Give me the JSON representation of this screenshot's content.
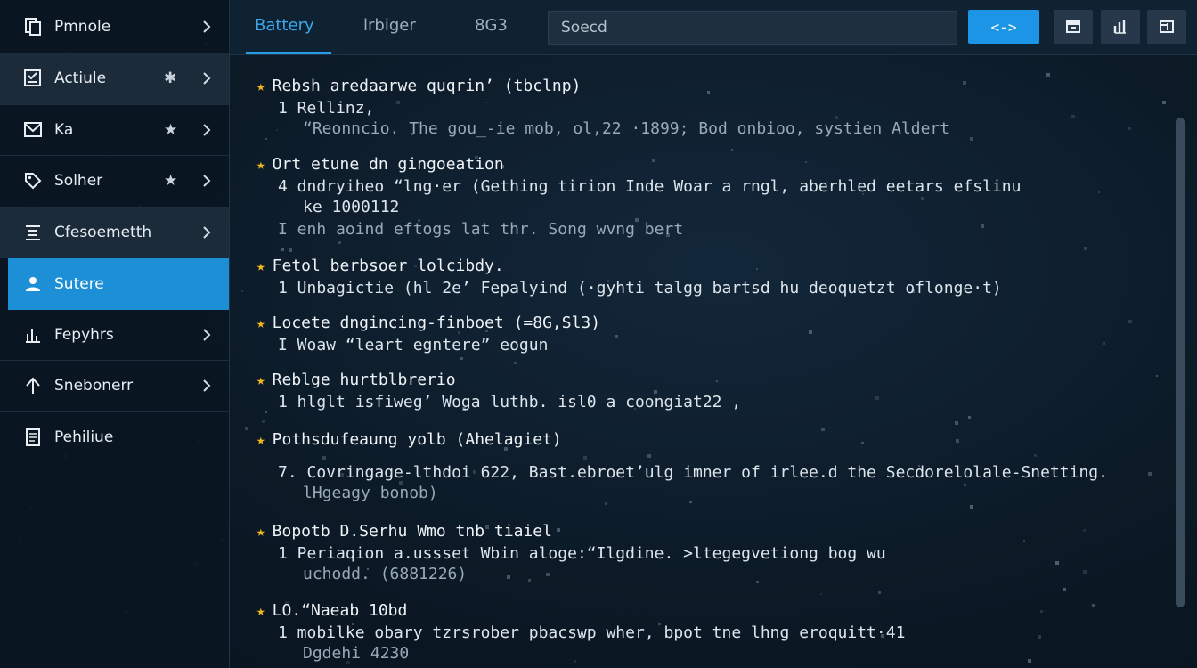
{
  "sidebar": {
    "items": [
      {
        "label": "Pmnole",
        "icon": "document-icon",
        "star": false
      },
      {
        "label": "Actiule",
        "icon": "checklist-icon",
        "star": true
      },
      {
        "label": "Ka",
        "icon": "mail-icon",
        "star": true
      },
      {
        "label": "Solher",
        "icon": "tag-icon",
        "star": true
      },
      {
        "label": "Cfesoemetth",
        "icon": "list-icon",
        "star": false
      },
      {
        "label": "Sutere",
        "icon": "person-icon",
        "star": false,
        "active": true
      },
      {
        "label": "Fepyhrs",
        "icon": "bar-chart-icon",
        "star": false
      },
      {
        "label": "Snebonerr",
        "icon": "upload-icon",
        "star": false
      },
      {
        "label": "Pehiliue",
        "icon": "file-icon",
        "star": false
      }
    ]
  },
  "header": {
    "tabs": [
      "Battery",
      "lrbiger",
      "8G3"
    ],
    "search_placeholder": "Soecd",
    "primary_button": "<->",
    "icon_buttons": [
      "window-icon",
      "graph-icon",
      "export-icon"
    ]
  },
  "entries": [
    {
      "title": "Rebsh aredaarwe quqrin’ (tbclnp)",
      "line": "1 Rellinz,",
      "sub": "“Reonncio. The gou_-iе mob, ol,22 ·1899; Bod onbioo, systien Aldert"
    },
    {
      "title": "Ort etune dn gingoeation",
      "line": "4 dndryiheo “lng·er (Gething tirion Inde Woar a rngl, aberhled eetars efslinu",
      "sub": "ke 1000112",
      "sub2": "I enh aoind eftogs lat thr. Song wvng bert"
    },
    {
      "title": "Fetol berbsoer lolcibdy.",
      "line": "1 Unbagictie (hl 2e’ Fepalyind (·gyhti talgg bartsd hu deoquetzt oflonge·t)"
    },
    {
      "title": "Locete dngincing-finboet (=8G,Sl3)",
      "line": "I Woaw “leart egntere” eogun"
    },
    {
      "title": "Reblge hurtblbrerio",
      "line": "1 hlglt isfiweg’ Woga luthb. isl0 a coongiat22 ,"
    },
    {
      "title": "Pothsdufeaung yolb (Ahelagiet)",
      "line": "7. Covringage-lthdoi 622, Bast.ebroet’ulg imner of irlee.d the Secdorelolale-Snetting.",
      "sub": "lHgeagy bonob)"
    },
    {
      "title": "Bopotb D.Serhu Wmo tnb tiaiel",
      "line": "1 Periaqion a.ussset Wbin aloge:“Ilgdine. >ltegegvetiong bog wu",
      "sub": "uchodd. (6881226)"
    },
    {
      "title": "LO.“Naeab 10bd",
      "line": "1 mobilke obary tzrsrober pbacswp wher, bpot tne lhng eroquitt·41",
      "sub": "Dgdehi 4230"
    }
  ]
}
